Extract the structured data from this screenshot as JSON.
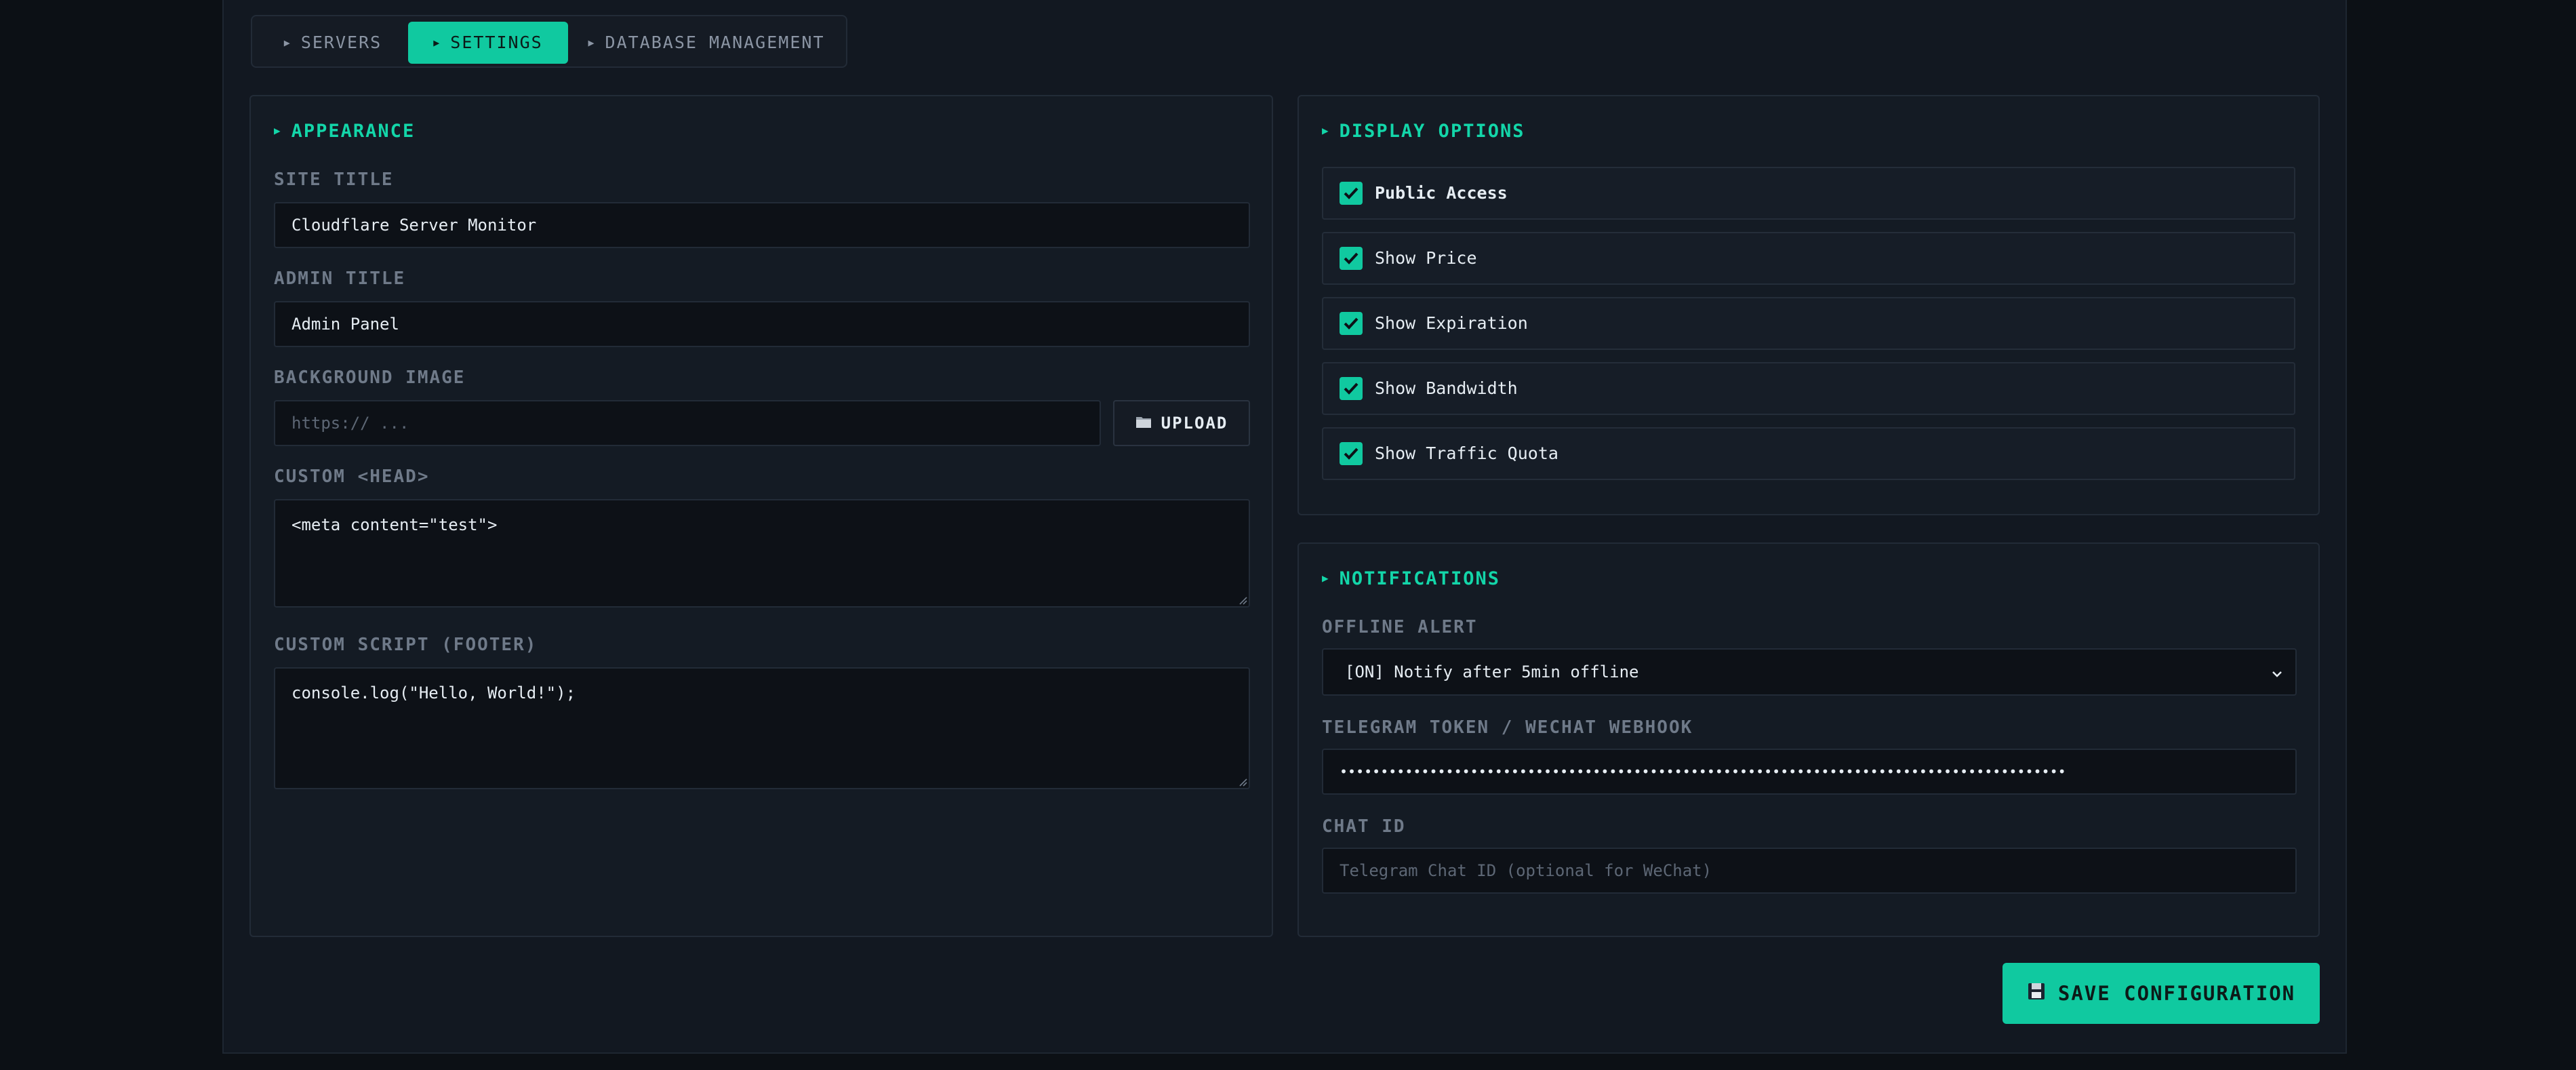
{
  "tabs": [
    {
      "label": "SERVERS"
    },
    {
      "label": "SETTINGS"
    },
    {
      "label": "DATABASE MANAGEMENT"
    }
  ],
  "appearance": {
    "title": "APPEARANCE",
    "site_title_label": "SITE TITLE",
    "site_title_value": "Cloudflare Server Monitor",
    "admin_title_label": "ADMIN TITLE",
    "admin_title_value": "Admin Panel",
    "bg_image_label": "BACKGROUND IMAGE",
    "bg_image_placeholder": "https:// ...",
    "upload_label": "UPLOAD",
    "custom_head_label": "CUSTOM <HEAD>",
    "custom_head_value": "<meta content=\"test\">",
    "custom_script_label": "CUSTOM SCRIPT (FOOTER)",
    "custom_script_value": "console.log(\"Hello, World!\");"
  },
  "display_options": {
    "title": "DISPLAY OPTIONS",
    "options": [
      {
        "label": "Public Access",
        "checked": true
      },
      {
        "label": "Show Price",
        "checked": true
      },
      {
        "label": "Show Expiration",
        "checked": true
      },
      {
        "label": "Show Bandwidth",
        "checked": true
      },
      {
        "label": "Show Traffic Quota",
        "checked": true
      }
    ]
  },
  "notifications": {
    "title": "NOTIFICATIONS",
    "offline_alert_label": "OFFLINE ALERT",
    "offline_alert_value": "[ON] Notify after 5min offline",
    "token_label": "TELEGRAM TOKEN / WECHAT WEBHOOK",
    "token_value": "•••••••••••••••••••••••••••••••••••••••••••••••••••••••••••••••••••••••••••••••••••••••••",
    "chat_id_label": "CHAT ID",
    "chat_id_placeholder": "Telegram Chat ID (optional for WeChat)"
  },
  "save_label": "SAVE CONFIGURATION",
  "colors": {
    "accent": "#10c9a0",
    "background": "#0c1015",
    "panel": "#141b24"
  }
}
